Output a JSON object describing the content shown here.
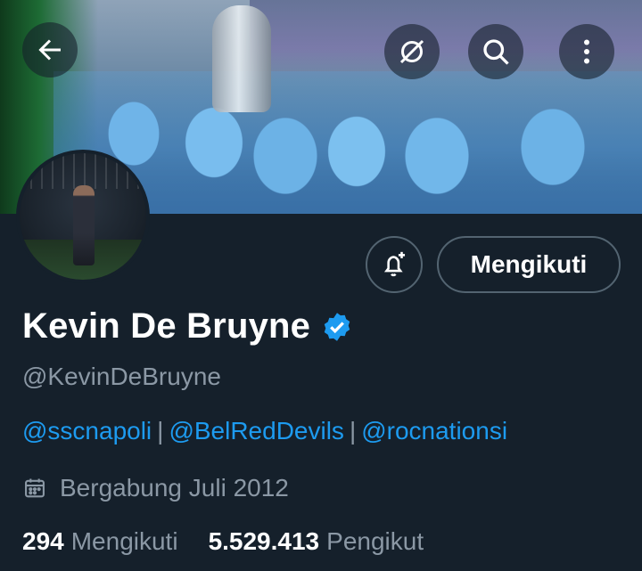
{
  "header": {
    "back_icon": "arrow-left-icon",
    "hide_icon": "eye-slash-icon",
    "search_icon": "search-icon",
    "more_icon": "more-vertical-icon"
  },
  "profile": {
    "name": "Kevin De Bruyne",
    "verified": true,
    "handle": "@KevinDeBruyne",
    "bio_links": [
      "@sscnapoli",
      "@BelRedDevils",
      "@rocnationsi"
    ],
    "bio_separator": "|",
    "joined": "Bergabung Juli 2012"
  },
  "actions": {
    "notify_icon": "bell-plus-icon",
    "follow_label": "Mengikuti"
  },
  "stats": {
    "following_count": "294",
    "following_label": "Mengikuti",
    "followers_count": "5.529.413",
    "followers_label": "Pengikut"
  },
  "colors": {
    "background": "#15202b",
    "link": "#1d9bf0",
    "muted_text": "#8b98a5",
    "verified": "#1d9bf0"
  }
}
